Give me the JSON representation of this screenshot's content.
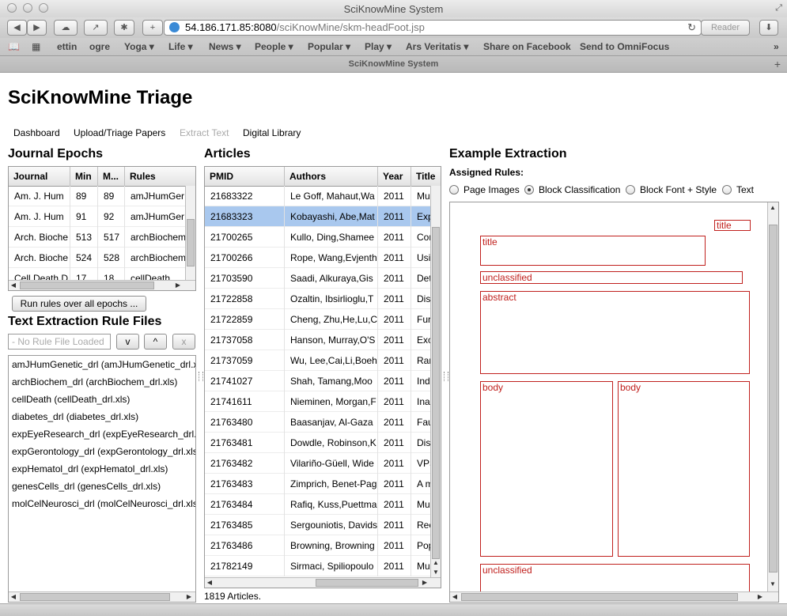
{
  "window": {
    "title": "SciKnowMine System"
  },
  "browser": {
    "url_host": "54.186.171.85:8080",
    "url_path": "/sciKnowMine/skm-headFoot.jsp",
    "reader_label": "Reader",
    "tab_title": "SciKnowMine System"
  },
  "bookmarks": [
    {
      "label": "ettin"
    },
    {
      "label": "ogre"
    },
    {
      "label": "Yoga ▾"
    },
    {
      "label": "Life ▾"
    },
    {
      "label": "News ▾"
    },
    {
      "label": "People ▾"
    },
    {
      "label": "Popular ▾"
    },
    {
      "label": "Play ▾"
    },
    {
      "label": "Ars Veritatis ▾"
    },
    {
      "label": "Share on Facebook"
    },
    {
      "label": "Send to OmniFocus"
    }
  ],
  "app": {
    "title": "SciKnowMine Triage"
  },
  "nav": [
    {
      "label": "Dashboard"
    },
    {
      "label": "Upload/Triage Papers"
    },
    {
      "label": "Extract Text"
    },
    {
      "label": "Digital Library"
    }
  ],
  "epochs": {
    "heading": "Journal Epochs",
    "columns": [
      "Journal",
      "Min",
      "M...",
      "Rules"
    ],
    "rows": [
      [
        "Am. J. Hum",
        "89",
        "89",
        "amJHumGer"
      ],
      [
        "Am. J. Hum",
        "91",
        "92",
        "amJHumGer"
      ],
      [
        "Arch. Bioche",
        "513",
        "517",
        "archBiochem"
      ],
      [
        "Arch. Bioche",
        "524",
        "528",
        "archBiochem"
      ],
      [
        "Cell Death D",
        "17",
        "18",
        "cellDeath"
      ]
    ],
    "run_button": "Run rules over all epochs ..."
  },
  "rule_files": {
    "heading": "Text Extraction Rule Files",
    "placeholder": "- No Rule File Loaded -",
    "down_button": "v",
    "up_button": "^",
    "remove_button": "x",
    "items": [
      "amJHumGenetic_drl (amJHumGenetic_drl.xls)",
      "archBiochem_drl (archBiochem_drl.xls)",
      "cellDeath (cellDeath_drl.xls)",
      "diabetes_drl (diabetes_drl.xls)",
      "expEyeResearch_drl (expEyeResearch_drl.xls)",
      "expGerontology_drl (expGerontology_drl.xls)",
      "expHematol_drl (expHematol_drl.xls)",
      "genesCells_drl (genesCells_drl.xls)",
      "molCelNeurosci_drl (molCelNeurosci_drl.xls)"
    ]
  },
  "articles": {
    "heading": "Articles",
    "columns": [
      "PMID",
      "Authors",
      "Year",
      "Title"
    ],
    "rows": [
      [
        "21683322",
        "Le Goff, Mahaut,Wa",
        "2011",
        "Mu"
      ],
      [
        "21683323",
        "Kobayashi, Abe,Mat",
        "2011",
        "Exp"
      ],
      [
        "21700265",
        "Kullo, Ding,Shamee",
        "2011",
        "Con"
      ],
      [
        "21700266",
        "Rope, Wang,Evjenth",
        "2011",
        "Usi"
      ],
      [
        "21703590",
        "Saadi, Alkuraya,Gis",
        "2011",
        "Det"
      ],
      [
        "21722858",
        "Ozaltin, Ibsirlioglu,T",
        "2011",
        "Dis"
      ],
      [
        "21722859",
        "Cheng, Zhu,He,Lu,C",
        "2011",
        "Fur"
      ],
      [
        "21737058",
        "Hanson, Murray,O'S",
        "2011",
        "Exo"
      ],
      [
        "21737059",
        "Wu, Lee,Cai,Li,Boeh",
        "2011",
        "Rar"
      ],
      [
        "21741027",
        "Shah, Tamang,Moo",
        "2011",
        "Ind"
      ],
      [
        "21741611",
        "Nieminen, Morgan,F",
        "2011",
        "Ina"
      ],
      [
        "21763480",
        "Baasanjav, Al-Gaza",
        "2011",
        "Fau"
      ],
      [
        "21763481",
        "Dowdle, Robinson,K",
        "2011",
        "Dis"
      ],
      [
        "21763482",
        "Vilariño-Güell, Wide",
        "2011",
        "VPS"
      ],
      [
        "21763483",
        "Zimprich, Benet-Pag",
        "2011",
        "A m"
      ],
      [
        "21763484",
        "Rafiq, Kuss,Puettma",
        "2011",
        "Mu"
      ],
      [
        "21763485",
        "Sergouniotis, Davids",
        "2011",
        "Rec"
      ],
      [
        "21763486",
        "Browning, Browning",
        "2011",
        "Pop"
      ],
      [
        "21782149",
        "Sirmaci, Spiliopoulo",
        "2011",
        "Mu"
      ]
    ],
    "selected_index": 1,
    "count_label": "1819 Articles."
  },
  "extraction": {
    "heading": "Example Extraction",
    "assigned_label": "Assigned Rules:",
    "options": [
      {
        "label": "Page Images",
        "checked": false
      },
      {
        "label": "Block Classification",
        "checked": true
      },
      {
        "label": "Block Font + Style",
        "checked": false
      },
      {
        "label": "Text",
        "checked": false
      }
    ],
    "blocks": [
      "title",
      "title",
      "unclassified",
      "abstract",
      "body",
      "body",
      "unclassified"
    ],
    "block_color": "#c0201d"
  },
  "colors": {
    "selection": "#a9c8ee"
  }
}
